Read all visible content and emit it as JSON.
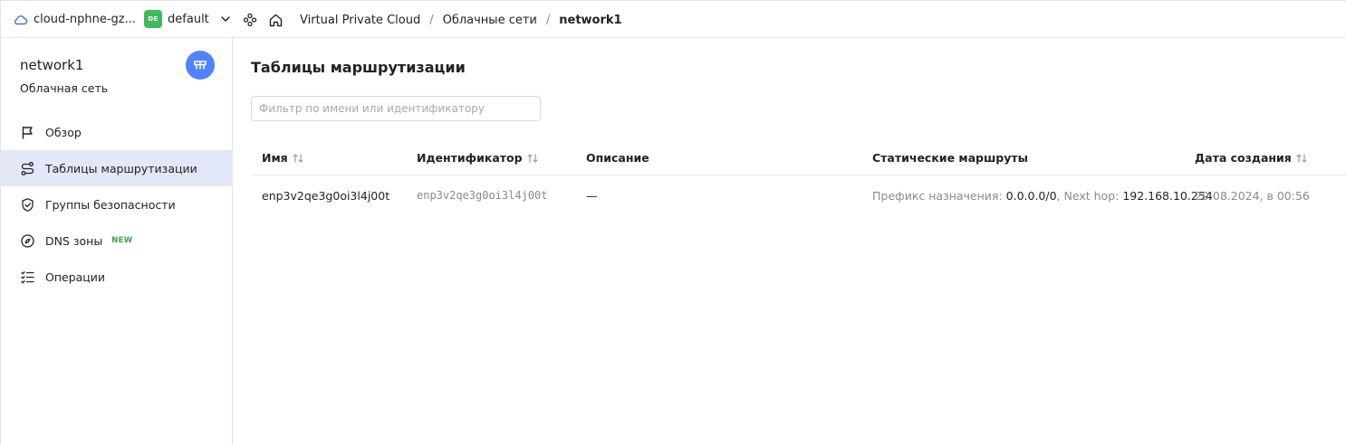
{
  "topbar": {
    "cloud_name": "cloud-nphne-gz...",
    "folder_badge": "DE",
    "folder_name": "default",
    "breadcrumbs": [
      "Virtual Private Cloud",
      "Облачные сети",
      "network1"
    ]
  },
  "sidebar": {
    "title": "network1",
    "subtitle": "Облачная сеть",
    "items": [
      {
        "label": "Обзор",
        "icon": "flag-icon"
      },
      {
        "label": "Таблицы маршрутизации",
        "icon": "route-icon",
        "active": true
      },
      {
        "label": "Группы безопасности",
        "icon": "shield-icon"
      },
      {
        "label": "DNS зоны",
        "icon": "compass-icon",
        "badge": "NEW"
      },
      {
        "label": "Операции",
        "icon": "list-check-icon"
      }
    ]
  },
  "main": {
    "title": "Таблицы маршрутизации",
    "filter_placeholder": "Фильтр по имени или идентификатору",
    "columns": [
      "Имя",
      "Идентификатор",
      "Описание",
      "Статические маршруты",
      "Дата создания"
    ],
    "rows": [
      {
        "name": "enp3v2qe3g0oi3l4j00t",
        "id": "enp3v2qe3g0oi3l4j00t",
        "description": "—",
        "route_prefix_label": "Префикс назначения:",
        "route_prefix": "0.0.0.0/0",
        "route_sep": ",",
        "route_hop_label": "Next hop:",
        "route_hop": "192.168.10.254",
        "created": "29.08.2024, в 00:56"
      }
    ]
  },
  "colors": {
    "accent": "#5282ff",
    "active_nav_bg": "#e3e8f8",
    "folder_badge": "#3dbb5b",
    "new_badge": "#33a64a"
  }
}
